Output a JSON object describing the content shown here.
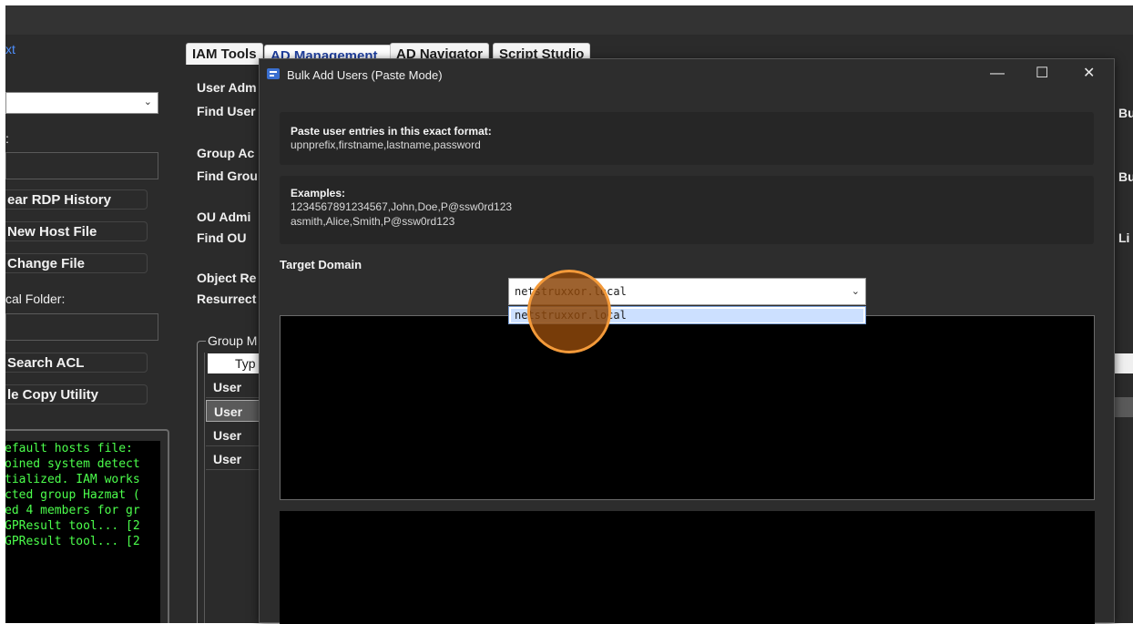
{
  "left_panel": {
    "blue_label": "xt",
    "label2": ":",
    "buttons": [
      "ear RDP History",
      "New Host File",
      "Change File"
    ],
    "local_folder_label": "cal Folder:",
    "buttons2": [
      "Search ACL",
      "le Copy Utility"
    ],
    "console_lines": [
      "efault hosts file:",
      "oined system detect",
      "tialized. IAM works",
      "cted group Hazmat (",
      "ed 4 members for gr",
      "GPResult tool... [2",
      "GPResult tool... [2"
    ]
  },
  "tabs": [
    "IAM Tools",
    "AD Management",
    "AD Navigator",
    "Script Studio"
  ],
  "main_bg": {
    "labels": [
      "User Adm",
      "Find User",
      "Group Ac",
      "Find Grou",
      "OU Admi",
      "Find OU",
      "Object Re",
      "Resurrect",
      "Group M"
    ],
    "right_labels": [
      "Bu",
      "Bu",
      "Li"
    ],
    "grid_header": "Typ",
    "grid_rows": [
      "User",
      "User",
      "User",
      "User"
    ]
  },
  "dialog": {
    "title": "Bulk Add Users (Paste Mode)",
    "window_buttons": {
      "minimize": "—",
      "maximize": "☐",
      "close": "✕"
    },
    "format_heading": "Paste user entries in this exact format:",
    "format_text": "upnprefix,firstname,lastname,password",
    "examples_heading": "Examples:",
    "examples": [
      "1234567891234567,John,Doe,P@ssw0rd123",
      "asmith,Alice,Smith,P@ssw0rd123"
    ],
    "target_domain_label": "Target Domain",
    "domain_selected": "netstruxxor.local",
    "domain_options": [
      "netstruxxor.local"
    ]
  }
}
